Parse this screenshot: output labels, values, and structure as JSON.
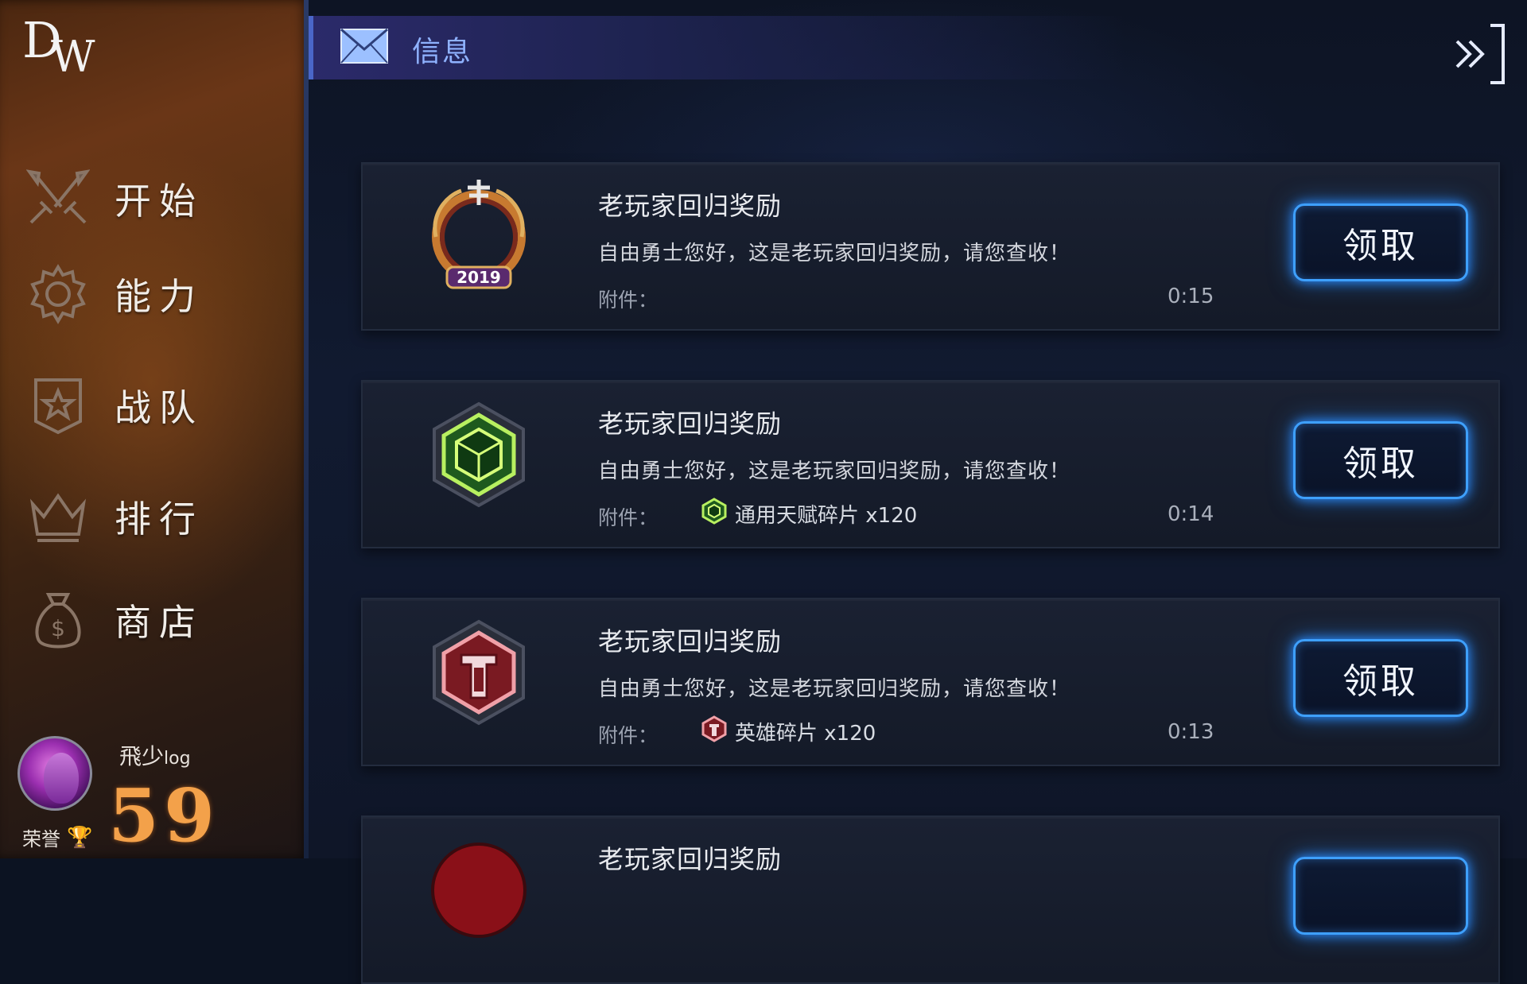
{
  "logo": {
    "d": "D",
    "w": "W"
  },
  "sidebar": {
    "items": [
      {
        "label": "开始",
        "icon": "crossed-swords-icon"
      },
      {
        "label": "能力",
        "icon": "gear-icon"
      },
      {
        "label": "战队",
        "icon": "shield-star-icon"
      },
      {
        "label": "排行",
        "icon": "crown-icon"
      },
      {
        "label": "商店",
        "icon": "money-bag-icon"
      }
    ]
  },
  "player": {
    "name": "飛少",
    "name_suffix": "log",
    "level": "59",
    "honor_label": "荣誉"
  },
  "header": {
    "title": "信息",
    "icon": "mail-icon",
    "close_icon": "collapse-panel-icon"
  },
  "mails": [
    {
      "title": "老玩家回归奖励",
      "message": "自由勇士您好，这是老玩家回归奖励，请您查收！",
      "attach_label": "附件：",
      "attachment": "",
      "time": "0:15",
      "button": "领取",
      "icon": "anniversary-2019-badge-icon",
      "badge_text": "2019"
    },
    {
      "title": "老玩家回归奖励",
      "message": "自由勇士您好，这是老玩家回归奖励，请您查收！",
      "attach_label": "附件：",
      "attachment": "通用天赋碎片 x120",
      "time": "0:14",
      "button": "领取",
      "icon": "green-talent-gem-icon"
    },
    {
      "title": "老玩家回归奖励",
      "message": "自由勇士您好，这是老玩家回归奖励，请您查收！",
      "attach_label": "附件：",
      "attachment": "英雄碎片 x120",
      "time": "0:13",
      "button": "领取",
      "icon": "red-hero-shard-icon"
    },
    {
      "title": "老玩家回归奖励",
      "icon": "red-reward-icon"
    }
  ],
  "colors": {
    "accent": "#3ea0ff",
    "level": "#f3a14a",
    "header_title": "#8fb2ff"
  }
}
